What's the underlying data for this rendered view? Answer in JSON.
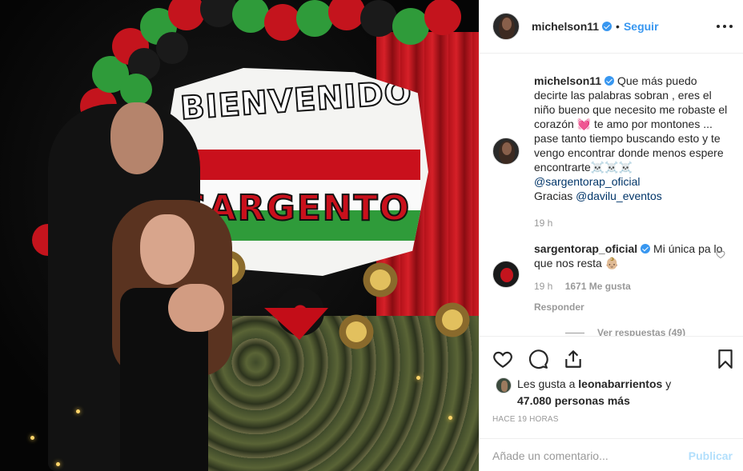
{
  "post": {
    "author": {
      "username": "michelson11",
      "verified": true,
      "follow_label": "Seguir",
      "separator": "•"
    },
    "photo": {
      "banner_title": "BIENVENIDO",
      "banner_name": "SARGENTO"
    },
    "caption": {
      "username": "michelson11",
      "text": "Que más puedo decirte las palabras sobran , eres el niño bueno que necesito me robaste el corazón 💓 te amo por montones ... pase tanto tiempo buscando esto y te vengo encontrar donde menos espere encontrarte☠️☠️☠️",
      "mention1": "@sargentorap_oficial",
      "gracias": "Gracias",
      "mention2": "@davilu_eventos",
      "time": "19 h"
    },
    "comments": [
      {
        "username": "sargentorap_oficial",
        "text": "Mi única pa lo que nos resta 👶🏼",
        "time": "19 h",
        "likes": "1671 Me gusta",
        "reply_label": "Responder"
      }
    ],
    "view_replies": "Ver respuestas (49)",
    "likes": {
      "prefix": "Les gusta a",
      "user": "leonabarrientos",
      "conj": "y",
      "count": "47.080",
      "suffix": "personas más"
    },
    "timestamp": "HACE 19 HORAS",
    "add_comment": {
      "placeholder": "Añade un comentario...",
      "publish_label": "Publicar"
    },
    "icons": {
      "more": "more-options-icon",
      "like": "heart-icon",
      "comment": "comment-icon",
      "share": "share-icon",
      "save": "bookmark-icon"
    },
    "colors": {
      "link_blue": "#3897f0",
      "publish_disabled": "#b2dffc",
      "muted": "#999999",
      "text": "#262626"
    }
  }
}
